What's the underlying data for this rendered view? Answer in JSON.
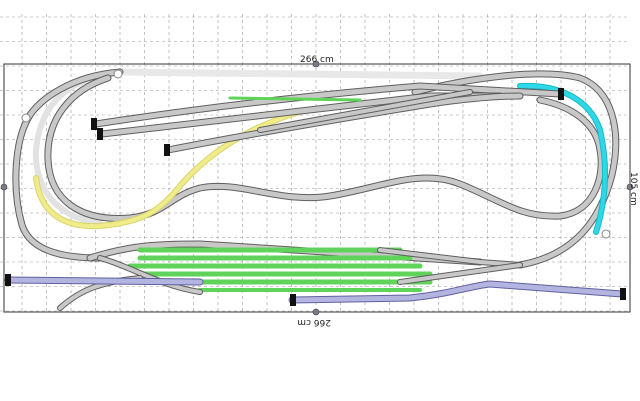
{
  "dimensions": {
    "top": "266 cm",
    "bottom": "266 cm",
    "right": "105 cm"
  },
  "colors": {
    "background": "#ffffff",
    "grid": "#9a9a9a",
    "track_grey": "#c8c8c8",
    "track_outline": "#5f5f5f",
    "track_green": "#5fd35a",
    "track_yellow": "#f0ec8a",
    "track_cyan": "#2ed8e6",
    "track_lavender": "#b4b4e0",
    "buffer_stop": "#111111",
    "dimension_marker": "#7a7a8a"
  },
  "icons": {
    "dimension_marker": "circle-marker-icon",
    "buffer_stop": "buffer-stop-icon"
  }
}
